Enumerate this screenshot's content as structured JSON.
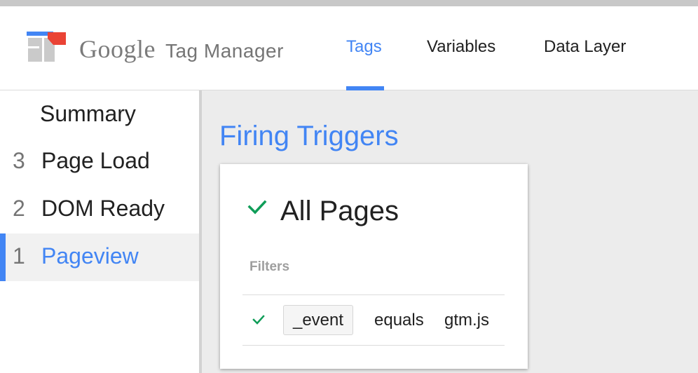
{
  "header": {
    "brand_google": "Google",
    "brand_product": "Tag Manager",
    "tabs": [
      {
        "label": "Tags",
        "active": true
      },
      {
        "label": "Variables",
        "active": false
      },
      {
        "label": "Data Layer",
        "active": false
      }
    ]
  },
  "sidebar": {
    "items": [
      {
        "num": "",
        "label": "Summary",
        "active": false
      },
      {
        "num": "3",
        "label": "Page Load",
        "active": false
      },
      {
        "num": "2",
        "label": "DOM Ready",
        "active": false
      },
      {
        "num": "1",
        "label": "Pageview",
        "active": true
      }
    ]
  },
  "main": {
    "title": "Firing Triggers",
    "card": {
      "trigger_name": "All Pages",
      "filters_label": "Filters",
      "filter": {
        "variable": "_event",
        "operator": "equals",
        "value": "gtm.js"
      }
    }
  },
  "icons": {
    "logo": "google-tag-manager-logo-icon",
    "check": "check-icon"
  },
  "colors": {
    "accent": "#4285f4",
    "check_green": "#0f9d58",
    "logo_red": "#ea4335",
    "logo_blue": "#4285f4",
    "logo_gray": "#9e9e9e"
  }
}
